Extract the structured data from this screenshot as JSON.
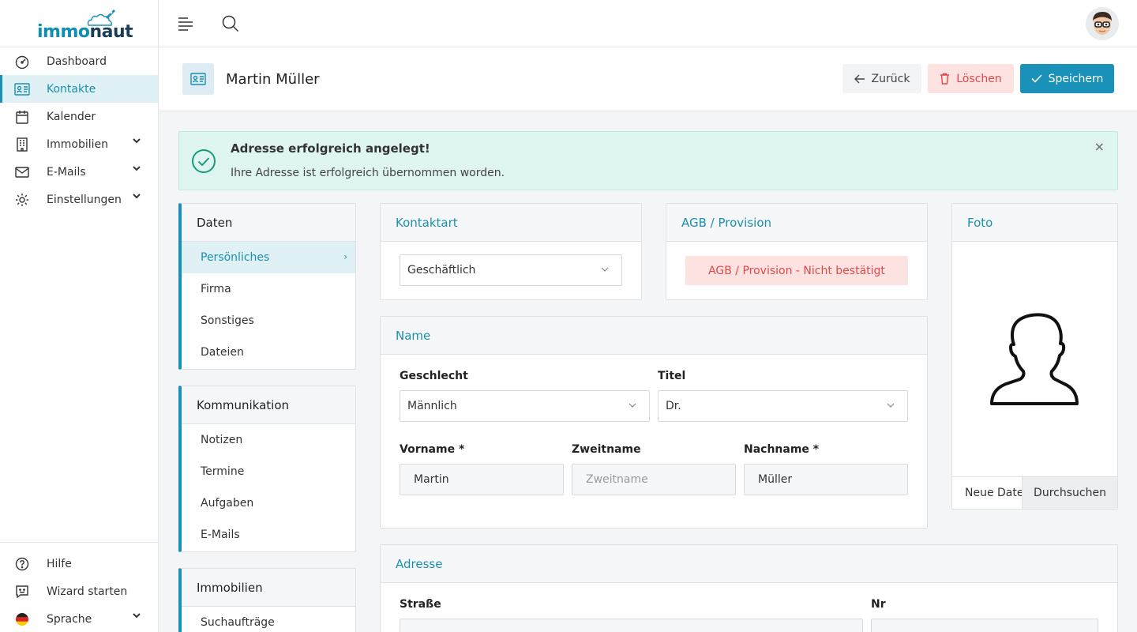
{
  "brand": {
    "part1": "immo",
    "part2": "naut"
  },
  "nav": [
    {
      "label": "Dashboard",
      "icon": "dashboard-icon"
    },
    {
      "label": "Kontakte",
      "icon": "contact-card-icon"
    },
    {
      "label": "Kalender",
      "icon": "calendar-icon"
    },
    {
      "label": "Immobilien",
      "icon": "building-icon"
    },
    {
      "label": "E-Mails",
      "icon": "mail-icon"
    },
    {
      "label": "Einstellungen",
      "icon": "gear-icon"
    }
  ],
  "nav_bottom": [
    {
      "label": "Hilfe",
      "icon": "help-icon"
    },
    {
      "label": "Wizard starten",
      "icon": "wizard-icon"
    },
    {
      "label": "Sprache",
      "icon": "flag-de-icon"
    }
  ],
  "page": {
    "title": "Martin Müller"
  },
  "buttons": {
    "back": "Zurück",
    "delete": "Löschen",
    "save": "Speichern"
  },
  "alert": {
    "title": "Adresse erfolgreich angelegt!",
    "text": "Ihre Adresse ist erfolgreich übernommen worden.",
    "close": "×"
  },
  "subnav": {
    "daten": {
      "title": "Daten",
      "items": [
        "Persönliches",
        "Firma",
        "Sonstiges",
        "Dateien"
      ]
    },
    "kommunikation": {
      "title": "Kommunikation",
      "items": [
        "Notizen",
        "Termine",
        "Aufgaben",
        "E-Mails"
      ]
    },
    "immobilien": {
      "title": "Immobilien",
      "items": [
        "Suchaufträge"
      ]
    }
  },
  "kontaktart": {
    "title": "Kontaktart",
    "value": "Geschäftlich"
  },
  "agb": {
    "title": "AGB / Provision",
    "status": "AGB / Provision - Nicht bestätigt"
  },
  "foto": {
    "title": "Foto",
    "file_placeholder": "Neue Datei",
    "browse": "Durchsuchen"
  },
  "name": {
    "title": "Name",
    "geschlecht_label": "Geschlecht",
    "geschlecht_value": "Männlich",
    "titel_label": "Titel",
    "titel_value": "Dr.",
    "vorname_label": "Vorname *",
    "vorname_value": "Martin",
    "zweitname_label": "Zweitname",
    "zweitname_placeholder": "Zweitname",
    "nachname_label": "Nachname *",
    "nachname_value": "Müller"
  },
  "adresse": {
    "title": "Adresse",
    "strasse_label": "Straße",
    "nr_label": "Nr"
  },
  "colors": {
    "accent": "#1a91b8",
    "danger": "#e04a4a",
    "success_bg": "#dff5f0"
  }
}
